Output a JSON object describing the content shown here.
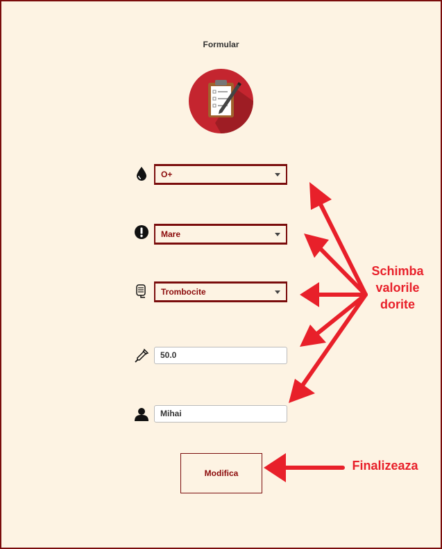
{
  "form": {
    "title": "Formular",
    "logo_icon": "clipboard-icon",
    "blood_type": {
      "icon": "blood-drop-icon",
      "value": "O+"
    },
    "priority": {
      "icon": "exclamation-icon",
      "value": "Mare"
    },
    "component": {
      "icon": "blood-bag-icon",
      "value": "Trombocite"
    },
    "quantity": {
      "icon": "pipette-icon",
      "value": "50.0"
    },
    "name": {
      "icon": "user-icon",
      "value": "Mihai"
    },
    "submit_label": "Modifica"
  },
  "annotations": {
    "change_values": [
      "Schimba",
      "valorile",
      "dorite"
    ],
    "finalize": "Finalizeaza",
    "color": "#e8202a"
  },
  "colors": {
    "background": "#fdf3e3",
    "accent": "#7a0c0c",
    "text_accent": "#8b0a0a"
  }
}
